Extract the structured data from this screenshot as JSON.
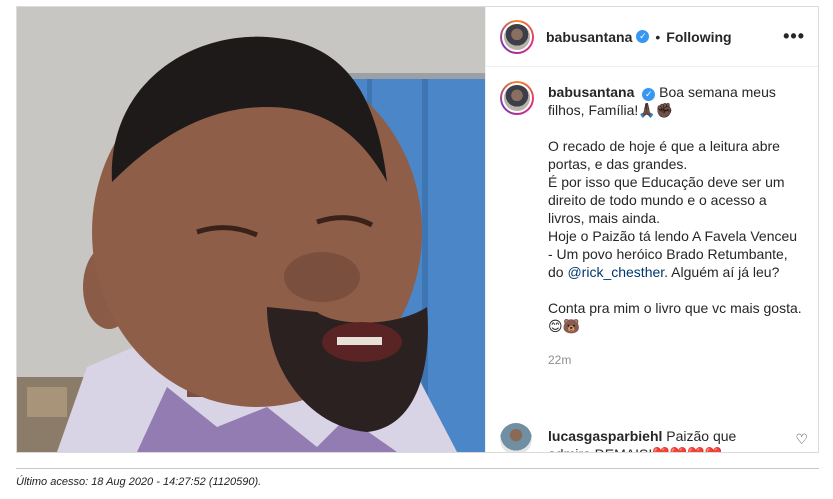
{
  "header": {
    "username": "babusantana",
    "verified_glyph": "✓",
    "separator": "•",
    "follow_status": "Following",
    "more_glyph": "•••"
  },
  "caption": {
    "username": "babusantana",
    "line1": "Boa semana meus filhos, Família!🙏🏿✊🏿",
    "para2": "O recado de hoje é que a leitura abre portas, e das grandes.",
    "para3": "É por isso que Educação deve ser um direito de todo mundo e o acesso a livros, mais ainda.",
    "para4_pre": "Hoje o Paizão tá lendo A Favela Venceu - Um povo heróico Brado Retumbante, do ",
    "mention": "@rick_chesther",
    "para4_post": ". Alguém aí já leu?",
    "para5": "Conta pra mim o livro que vc mais gosta. 😊🐻",
    "time": "22m"
  },
  "comment": {
    "username": "lucasgasparbiehl",
    "text": "Paizão que admiro DEMAIS!❤️❤️❤️❤️"
  },
  "icons": {
    "avatar": "profile-avatar",
    "verified": "verified-badge-icon",
    "more": "more-options-icon",
    "like": "heart-icon"
  },
  "colors": {
    "verified_blue": "#3897f0",
    "mention_blue": "#00376b",
    "muted_gray": "#8e8e8e",
    "text": "#262626"
  },
  "footer": {
    "label": "Último acesso: 18 Aug 2020 - 14:27:52 (1120590)."
  }
}
